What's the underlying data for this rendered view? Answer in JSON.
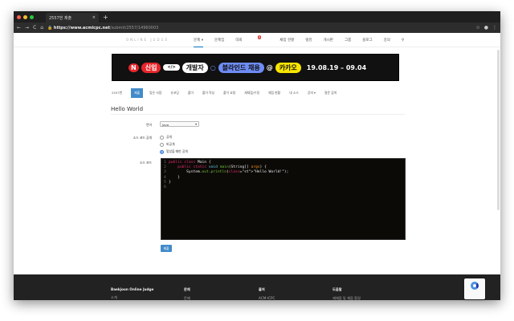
{
  "browser": {
    "tab_title": "2557번 제출",
    "url_host": "https://www.acmicpc.net",
    "url_path": "/submit/2557/14960003"
  },
  "site": {
    "logo_sub": "ONLINE JUDGE"
  },
  "nav": [
    {
      "label": "문제 ▾"
    },
    {
      "label": "문제집"
    },
    {
      "label": "대회"
    },
    {
      "label": "채점 현황"
    },
    {
      "label": "랭킹"
    },
    {
      "label": "게시판"
    },
    {
      "label": "그룹"
    },
    {
      "label": "블로그"
    },
    {
      "label": "강의"
    }
  ],
  "nav_badge": "0",
  "banner": {
    "n": "N",
    "new": "신입",
    "code": "</>",
    "dev": "개발자",
    "blind": "블라인드 채용",
    "at": "@",
    "kakao": "카카오",
    "dates": "19.08.19 – 09.04"
  },
  "subnav": [
    "2557번",
    "제출",
    "맞은 사람",
    "숏코딩",
    "풀이",
    "풀이 작성",
    "풀이 요청",
    "재채점/수정",
    "채점 현황",
    "내 소스",
    "강의 ▾",
    "질문 검색"
  ],
  "problem_title": "Hello World",
  "form": {
    "language_label": "언어",
    "language_value": "Java",
    "visibility_label": "소스 코드 공개",
    "options": [
      "공개",
      "비공개",
      "맞았을 때만 공개"
    ],
    "selected_option": 2,
    "source_label": "소스 코드",
    "submit_label": "제출"
  },
  "code_lines": [
    "public class Main {",
    "    public static void main(String[] args) {",
    "        System.out.println(\"Hello World!\");",
    "    }",
    "}",
    ""
  ],
  "footer": [
    {
      "title": "Baekjoon Online Judge",
      "item": "소개"
    },
    {
      "title": "문제",
      "item": "문제"
    },
    {
      "title": "출처",
      "item": "ACM-ICPC"
    },
    {
      "title": "도움말",
      "item": "재채점 및 채점 환경"
    }
  ]
}
